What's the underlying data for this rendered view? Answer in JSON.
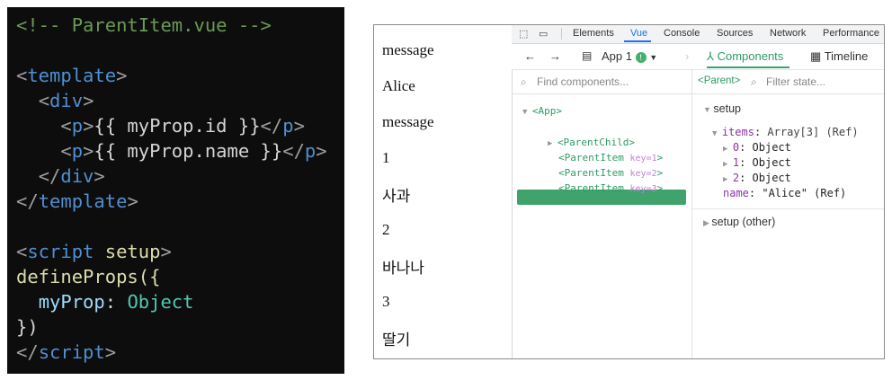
{
  "code": {
    "comment": "<!-- ParentItem.vue -->",
    "template_tag": "template",
    "div_tag": "div",
    "p_tag": "p",
    "line_id": "{{ myProp.id }}",
    "line_name": "{{ myProp.name }}",
    "script_tag": "script",
    "setup_attr": "setup",
    "define_props": "defineProps({",
    "prop_name": "myProp",
    "prop_type": "Object",
    "close_call": "})"
  },
  "page": {
    "items": [
      "message",
      "Alice",
      "message",
      "1",
      "사과",
      "2",
      "바나나",
      "3",
      "딸기"
    ]
  },
  "devtools": {
    "tabs": [
      "Elements",
      "Vue",
      "Console",
      "Sources",
      "Network",
      "Performance"
    ],
    "active_tab": "Vue",
    "app_label": "App 1",
    "components_label": "Components",
    "timeline_label": "Timeline",
    "find_placeholder": "Find components...",
    "selected_component": "<Parent>",
    "filter_placeholder": "Filter state...",
    "tree": {
      "app": "<App>",
      "parent": "<Parent>",
      "parent_child": "<ParentChild>",
      "parent_item": "<ParentItem",
      "keys": [
        "key=1",
        "key=2",
        "key=3"
      ],
      "close": ">"
    },
    "state": {
      "setup_label": "setup",
      "items_key": "items",
      "items_value": "Array[3] (Ref)",
      "entries": [
        {
          "key": "0",
          "value": "Object"
        },
        {
          "key": "1",
          "value": "Object"
        },
        {
          "key": "2",
          "value": "Object"
        }
      ],
      "name_key": "name",
      "name_value": "\"Alice\" (Ref)",
      "setup_other_label": "setup (other)"
    }
  }
}
